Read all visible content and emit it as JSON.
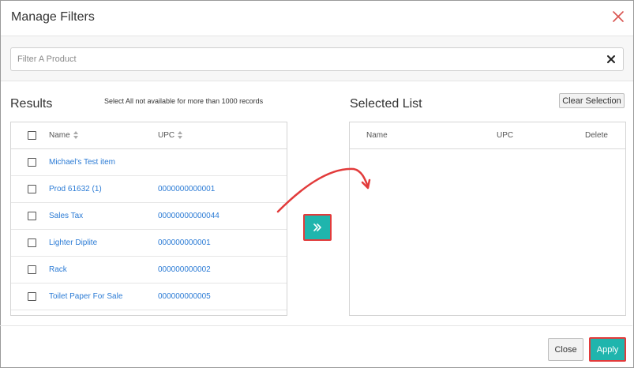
{
  "dialog": {
    "title": "Manage Filters"
  },
  "filter": {
    "placeholder": "Filter A Product",
    "value": ""
  },
  "results": {
    "title": "Results",
    "note": "Select All not available for more than 1000 records",
    "columns": {
      "name": "Name",
      "upc": "UPC"
    },
    "rows": [
      {
        "name": "Michael's Test item",
        "upc": ""
      },
      {
        "name": "Prod 61632 (1)",
        "upc": "0000000000001"
      },
      {
        "name": "Sales Tax",
        "upc": "00000000000044"
      },
      {
        "name": "Lighter Diplite",
        "upc": "000000000001"
      },
      {
        "name": "Rack",
        "upc": "000000000002"
      },
      {
        "name": "Toilet Paper For Sale",
        "upc": "000000000005"
      }
    ]
  },
  "selected": {
    "title": "Selected List",
    "clear_label": "Clear Selection",
    "columns": {
      "name": "Name",
      "upc": "UPC",
      "delete": "Delete"
    }
  },
  "footer": {
    "close_label": "Close",
    "apply_label": "Apply"
  },
  "colors": {
    "accent": "#1fb5ad",
    "highlight": "#e23b3b",
    "link": "#2b7bd5"
  },
  "icons": {
    "close": "close-x-icon",
    "clear": "clear-x-icon",
    "sort": "sort-icon",
    "transfer": "double-chevron-right-icon"
  }
}
